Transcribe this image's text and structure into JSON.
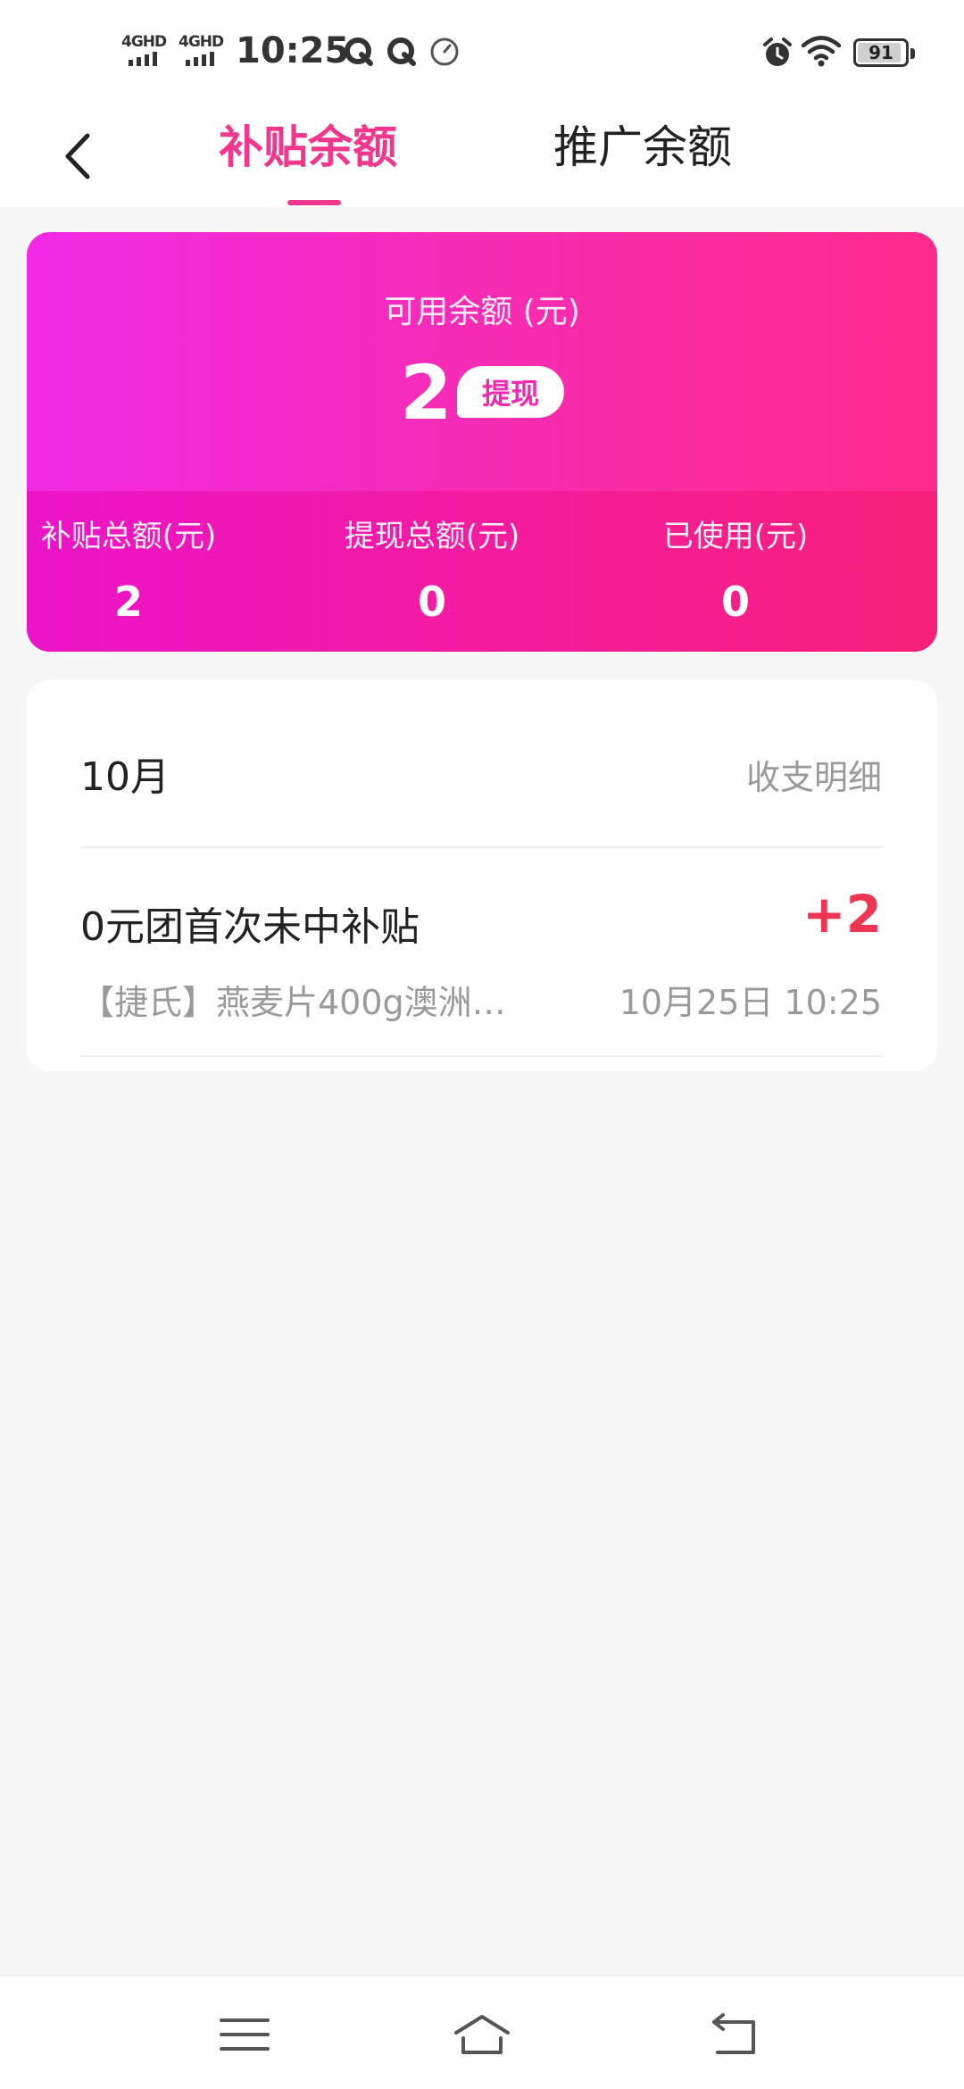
{
  "status_bar": {
    "network_1": "4GHD",
    "network_2": "4GHD",
    "time": "10:25",
    "battery": "91",
    "icons": [
      "signal-icon",
      "signal-icon",
      "q-app-icon",
      "q-app-icon",
      "clock-icon",
      "alarm-icon",
      "wifi-icon",
      "battery-icon"
    ]
  },
  "header": {
    "back_icon": "back-arrow-icon",
    "tabs": [
      {
        "label": "补贴余额",
        "active": true
      },
      {
        "label": "推广余额",
        "active": false
      }
    ],
    "accent_color": "#f0378d"
  },
  "balance_card": {
    "label": "可用余额 (元)",
    "amount": "2",
    "withdraw_label": "提现",
    "stats": [
      {
        "label": "补贴总额(元)",
        "value": "2"
      },
      {
        "label": "提现总额(元)",
        "value": "0"
      },
      {
        "label": "已使用(元)",
        "value": "0"
      }
    ],
    "gradient_colors": [
      "#f229e5",
      "#fe2b8b"
    ]
  },
  "detail": {
    "month": "10月",
    "link_label": "收支明细",
    "transactions": [
      {
        "title": "0元团首次未中补贴",
        "amount": "+2",
        "description": "【捷氏】燕麦片400g澳洲…",
        "time": "10月25日 10:25"
      }
    ],
    "amount_color": "#ee3553"
  },
  "nav_bar": {
    "icons": [
      "menu-icon",
      "home-icon",
      "back-icon"
    ]
  }
}
